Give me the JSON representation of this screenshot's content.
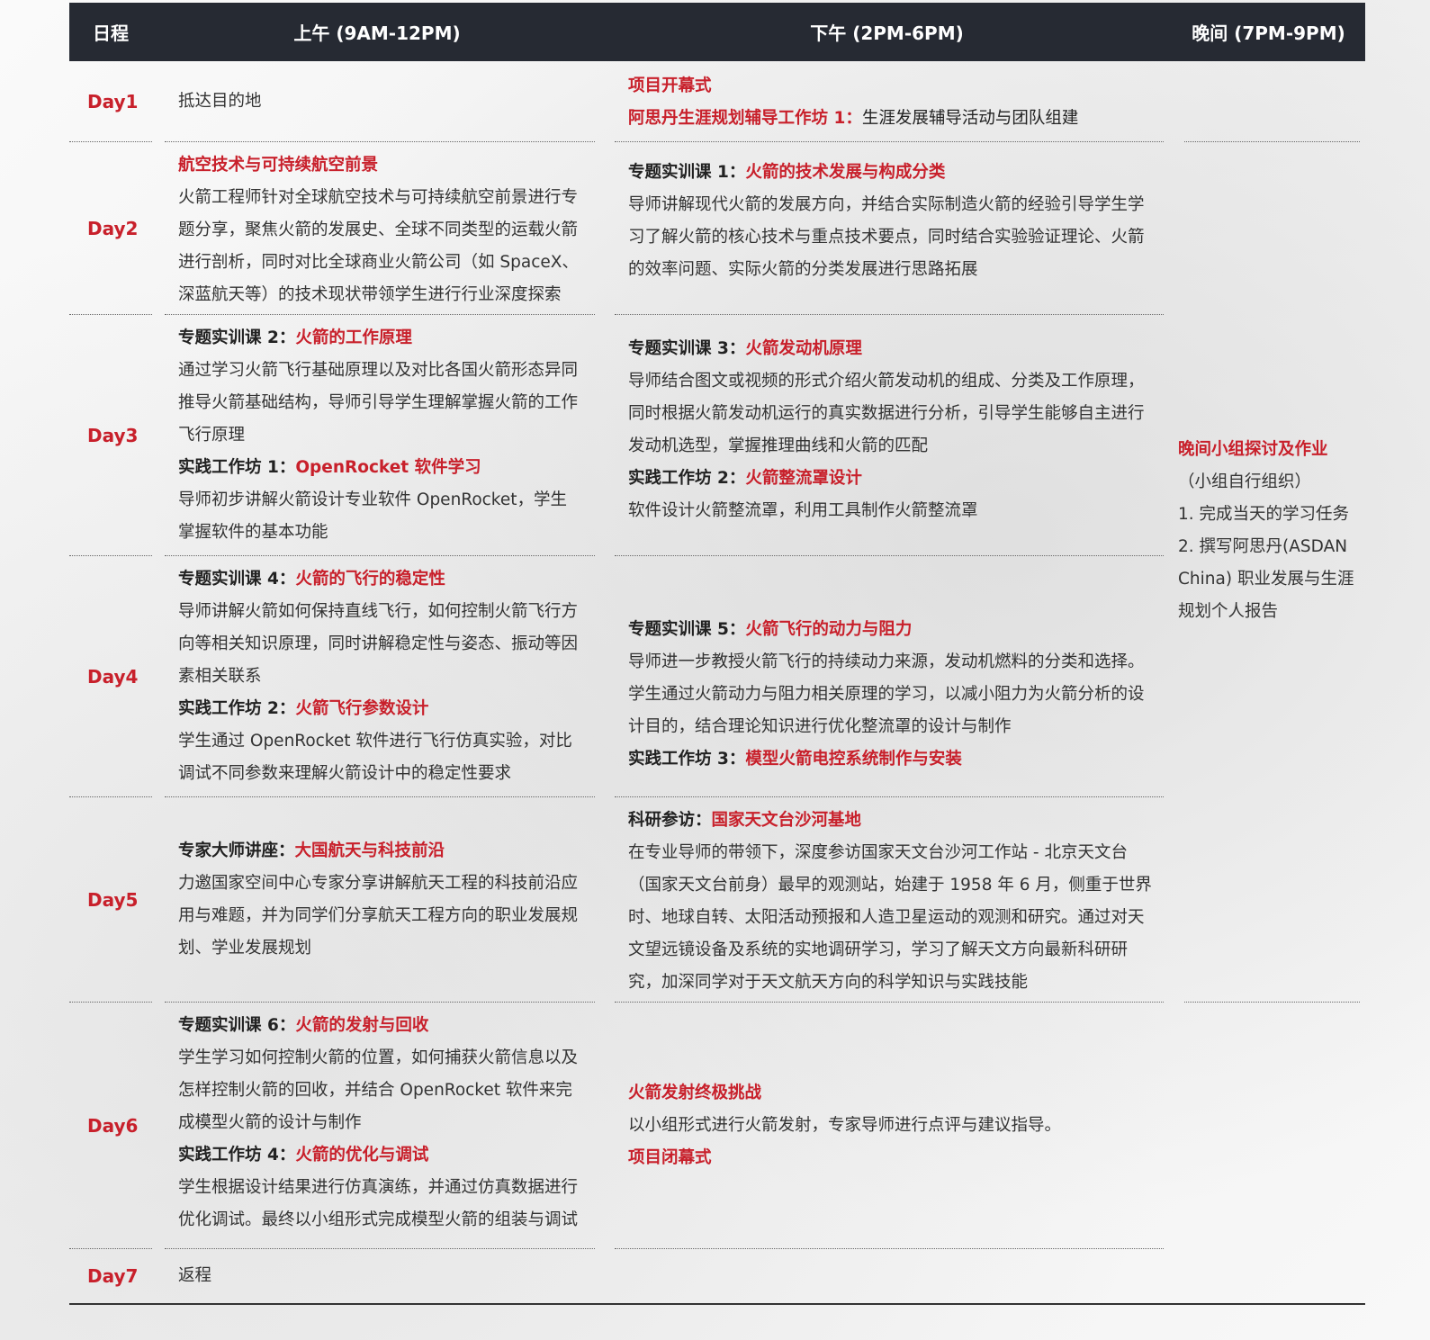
{
  "header": {
    "day": "日程",
    "am": "上午 (9AM-12PM)",
    "pm": "下午 (2PM-6PM)",
    "ev": "晚间 (7PM-9PM)"
  },
  "days": [
    {
      "label": "Day1",
      "am": [
        {
          "text": "抵达目的地"
        }
      ],
      "pm": [
        {
          "heading_red": "项目开幕式"
        },
        {
          "heading_red": "阿思丹生涯规划辅导工作坊 1：",
          "suffix": "生涯发展辅导活动与团队组建"
        }
      ]
    },
    {
      "label": "Day2",
      "am": [
        {
          "heading_red": "航空技术与可持续航空前景"
        },
        {
          "text": "火箭工程师针对全球航空技术与可持续航空前景进行专题分享，聚焦火箭的发展史、全球不同类型的运载火箭进行剖析，同时对比全球商业火箭公司（如 SpaceX、深蓝航天等）的技术现状带领学生进行行业深度探索"
        }
      ],
      "pm": [
        {
          "heading": "专题实训课 1：",
          "heading_red": "火箭的技术发展与构成分类"
        },
        {
          "text": "导师讲解现代火箭的发展方向，并结合实际制造火箭的经验引导学生学习了解火箭的核心技术与重点技术要点，同时结合实验验证理论、火箭的效率问题、实际火箭的分类发展进行思路拓展"
        }
      ]
    },
    {
      "label": "Day3",
      "am": [
        {
          "heading": "专题实训课 2：",
          "heading_red": "火箭的工作原理"
        },
        {
          "text": "通过学习火箭飞行基础原理以及对比各国火箭形态异同推导火箭基础结构，导师引导学生理解掌握火箭的工作飞行原理"
        },
        {
          "heading": "实践工作坊 1：",
          "heading_red": "OpenRocket 软件学习"
        },
        {
          "text": "导师初步讲解火箭设计专业软件 OpenRocket，学生掌握软件的基本功能"
        }
      ],
      "pm": [
        {
          "heading": "专题实训课 3：",
          "heading_red": "火箭发动机原理"
        },
        {
          "text": "导师结合图文或视频的形式介绍火箭发动机的组成、分类及工作原理，同时根据火箭发动机运行的真实数据进行分析，引导学生能够自主进行发动机选型，掌握推理曲线和火箭的匹配"
        },
        {
          "heading": "实践工作坊 2：",
          "heading_red": "火箭整流罩设计"
        },
        {
          "text": "软件设计火箭整流罩，利用工具制作火箭整流罩"
        }
      ]
    },
    {
      "label": "Day4",
      "am": [
        {
          "heading": "专题实训课 4：",
          "heading_red": "火箭的飞行的稳定性"
        },
        {
          "text": "导师讲解火箭如何保持直线飞行，如何控制火箭飞行方向等相关知识原理，同时讲解稳定性与姿态、振动等因素相关联系"
        },
        {
          "heading": "实践工作坊 2：",
          "heading_red": "火箭飞行参数设计"
        },
        {
          "text": "学生通过 OpenRocket 软件进行飞行仿真实验，对比调试不同参数来理解火箭设计中的稳定性要求"
        }
      ],
      "pm": [
        {
          "heading": "专题实训课 5：",
          "heading_red": "火箭飞行的动力与阻力"
        },
        {
          "text": "导师进一步教授火箭飞行的持续动力来源，发动机燃料的分类和选择。学生通过火箭动力与阻力相关原理的学习，以减小阻力为火箭分析的设计目的，结合理论知识进行优化整流罩的设计与制作"
        },
        {
          "heading": "实践工作坊 3：",
          "heading_red": "模型火箭电控系统制作与安装"
        }
      ]
    },
    {
      "label": "Day5",
      "am": [
        {
          "heading": "专家大师讲座：",
          "heading_red": "大国航天与科技前沿"
        },
        {
          "text": "力邀国家空间中心专家分享讲解航天工程的科技前沿应用与难题，并为同学们分享航天工程方向的职业发展规划、学业发展规划"
        }
      ],
      "pm": [
        {
          "heading": "科研参访：",
          "heading_red": "国家天文台沙河基地"
        },
        {
          "text": "在专业导师的带领下，深度参访国家天文台沙河工作站 - 北京天文台（国家天文台前身）最早的观测站，始建于 1958 年 6 月，侧重于世界时、地球自转、太阳活动预报和人造卫星运动的观测和研究。通过对天文望远镜设备及系统的实地调研学习，学习了解天文方向最新科研研究，加深同学对于天文航天方向的科学知识与实践技能"
        }
      ]
    },
    {
      "label": "Day6",
      "am": [
        {
          "heading": "专题实训课 6：",
          "heading_red": "火箭的发射与回收"
        },
        {
          "text": "学生学习如何控制火箭的位置，如何捕获火箭信息以及怎样控制火箭的回收，并结合 OpenRocket 软件来完成模型火箭的设计与制作"
        },
        {
          "heading": "实践工作坊 4：",
          "heading_red": "火箭的优化与调试"
        },
        {
          "text": "学生根据设计结果进行仿真演练，并通过仿真数据进行优化调试。最终以小组形式完成模型火箭的组装与调试"
        }
      ],
      "pm": [
        {
          "heading_red": "火箭发射终极挑战"
        },
        {
          "text": "以小组形式进行火箭发射，专家导师进行点评与建议指导。"
        },
        {
          "heading_red": "项目闭幕式"
        }
      ]
    },
    {
      "label": "Day7",
      "am": [
        {
          "text": "返程"
        }
      ],
      "pm": []
    }
  ],
  "evening": {
    "title": "晚间小组探讨及作业",
    "note": "（小组自行组织）",
    "item1": "1. 完成当天的学习任务",
    "item2": "2. 撰写阿思丹(ASDAN China) 职业发展与生涯规划个人报告"
  }
}
